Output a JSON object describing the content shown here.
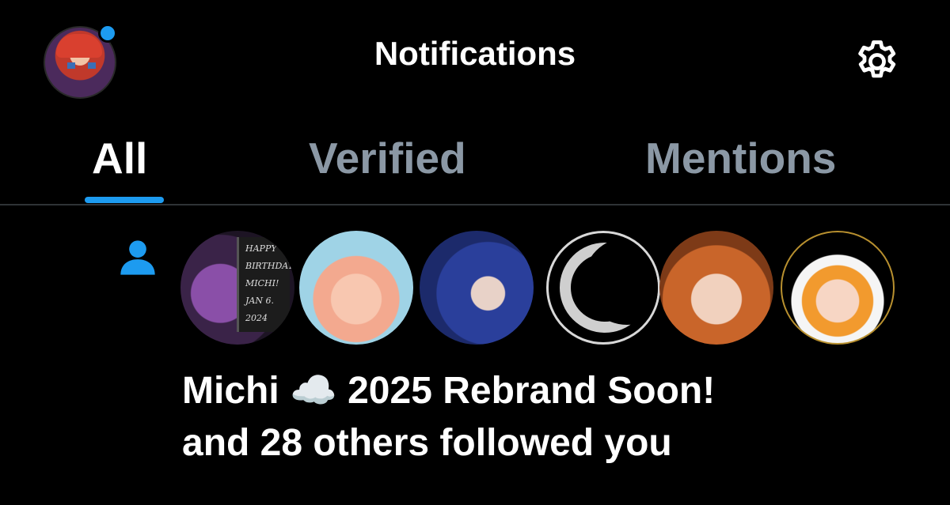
{
  "header": {
    "title": "Notifications",
    "settings_icon": "gear-icon",
    "profile_icon": "avatar",
    "accent": "#1d9bf0"
  },
  "tabs": [
    {
      "label": "All",
      "active": true
    },
    {
      "label": "Verified",
      "active": false
    },
    {
      "label": "Mentions",
      "active": false
    }
  ],
  "notification": {
    "icon": "person-icon",
    "avatar_count": 6,
    "birthday_card_text": [
      "HAPPY",
      "BIRTHDAY",
      "MICHI!",
      "JAN 6.",
      "2024"
    ],
    "line1": "Michi ☁️ 2025 Rebrand Soon!",
    "line2": "and 28 others followed you"
  }
}
